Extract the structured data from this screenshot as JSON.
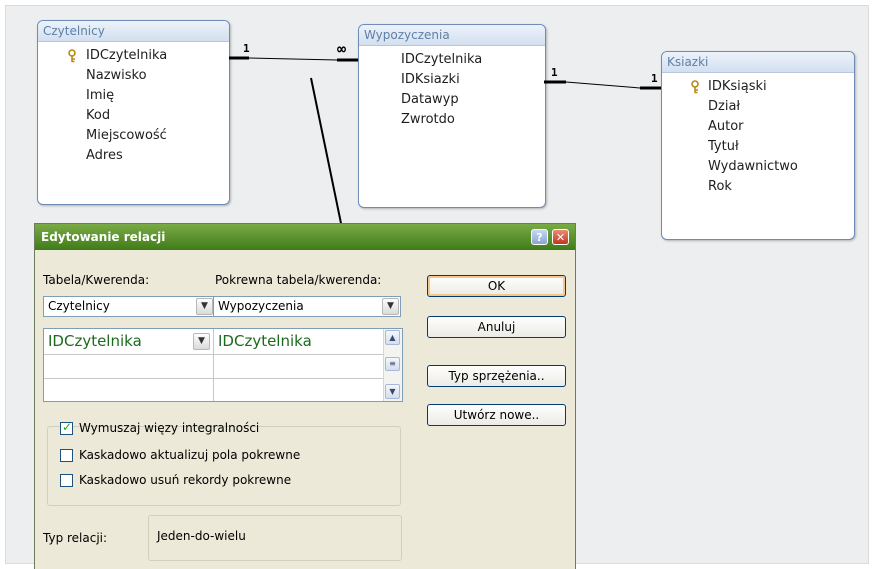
{
  "tables": {
    "czytelnicy": {
      "title": "Czytelnicy",
      "fields": [
        "IDCzytelnika",
        "Nazwisko",
        "Imię",
        "Kod",
        "Miejscowość",
        "Adres"
      ]
    },
    "wypozyczenia": {
      "title": "Wypozyczenia",
      "fields": [
        "IDCzytelnika",
        "IDKsiazki",
        "Datawyp",
        "Zwrotdo"
      ]
    },
    "ksiazki": {
      "title": "Ksiazki",
      "fields": [
        "IDKsiąski",
        "Dział",
        "Autor",
        "Tytuł",
        "Wydawnictwo",
        "Rok"
      ]
    }
  },
  "relations": {
    "one_a": "1",
    "many_a": "∞",
    "one_b": "1",
    "one_c": "1"
  },
  "dialog": {
    "title": "Edytowanie relacji",
    "table_label": "Tabela/Kwerenda:",
    "related_label": "Pokrewna tabela/kwerenda:",
    "table_value": "Czytelnicy",
    "related_value": "Wypozyczenia",
    "grid_left": "IDCzytelnika",
    "grid_right": "IDCzytelnika",
    "buttons": {
      "ok": "OK",
      "cancel": "Anuluj",
      "join": "Typ sprzężenia..",
      "new": "Utwórz nowe.."
    },
    "checks": {
      "integrity": "Wymuszaj więzy integralności",
      "cascade_update": "Kaskadowo aktualizuj pola pokrewne",
      "cascade_delete": "Kaskadowo usuń rekordy pokrewne"
    },
    "integrity_checked": true,
    "reltype_label": "Typ relacji:",
    "reltype_value": "Jeden-do-wielu"
  }
}
